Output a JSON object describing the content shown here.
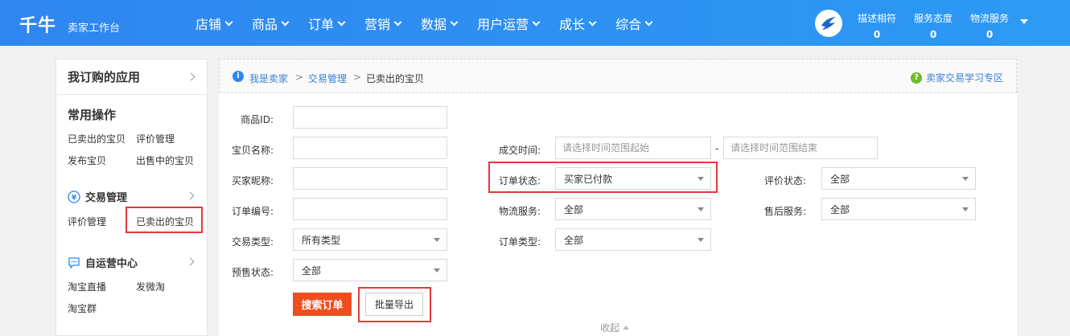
{
  "header": {
    "logo": "千牛",
    "subtitle": "卖家工作台",
    "nav": [
      "店铺",
      "商品",
      "订单",
      "营销",
      "数据",
      "用户运营",
      "成长",
      "综合"
    ],
    "scores": [
      {
        "label": "描述相符",
        "value": "0"
      },
      {
        "label": "服务态度",
        "value": "0"
      },
      {
        "label": "物流服务",
        "value": "0"
      }
    ]
  },
  "sidebar": {
    "title": "我订购的应用",
    "common_ops": {
      "title": "常用操作",
      "links": [
        "已卖出的宝贝",
        "评价管理",
        "发布宝贝",
        "出售中的宝贝"
      ]
    },
    "trade": {
      "title": "交易管理",
      "icon": "yen-icon",
      "links": [
        "评价管理",
        "已卖出的宝贝"
      ]
    },
    "self_ops": {
      "title": "自运营中心",
      "icon": "chat-icon",
      "links": [
        "淘宝直播",
        "发微淘",
        "淘宝群"
      ]
    }
  },
  "breadcrumb": {
    "items": [
      "我是卖家",
      "交易管理",
      "已卖出的宝贝"
    ],
    "sep": ">",
    "learn_link": "卖家交易学习专区"
  },
  "form": {
    "product_id": {
      "label": "商品ID:",
      "value": ""
    },
    "item_name": {
      "label": "宝贝名称:",
      "value": ""
    },
    "buyer_nick": {
      "label": "买家昵称:",
      "value": ""
    },
    "order_no": {
      "label": "订单编号:",
      "value": ""
    },
    "trade_type": {
      "label": "交易类型:",
      "value": "所有类型"
    },
    "presale_status": {
      "label": "预售状态:",
      "value": "全部"
    },
    "deal_time": {
      "label": "成交时间:",
      "start_placeholder": "请选择时间范围起始",
      "end_placeholder": "请选择时间范围结束",
      "dash": "-"
    },
    "order_status": {
      "label": "订单状态:",
      "value": "买家已付款"
    },
    "logistics": {
      "label": "物流服务:",
      "value": "全部"
    },
    "order_type": {
      "label": "订单类型:",
      "value": "全部"
    },
    "review_status": {
      "label": "评价状态:",
      "value": "全部"
    },
    "after_sale": {
      "label": "售后服务:",
      "value": "全部"
    }
  },
  "actions": {
    "search": "搜索订单",
    "export": "批量导出",
    "collapse": "收起"
  },
  "colors": {
    "brand": "#2f86f0",
    "primary_button": "#f04d1f",
    "highlight": "#e4393c"
  }
}
